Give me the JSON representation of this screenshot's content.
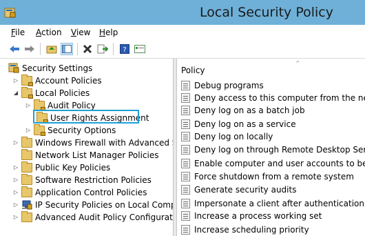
{
  "window": {
    "title": "Local Security Policy"
  },
  "menu": {
    "file": "File",
    "action": "Action",
    "view": "View",
    "help": "Help"
  },
  "tree": {
    "root": "Security Settings",
    "account_policies": "Account Policies",
    "local_policies": "Local Policies",
    "audit_policy": "Audit Policy",
    "user_rights": "User Rights Assignment",
    "security_options": "Security Options",
    "firewall": "Windows Firewall with Advanced Secu",
    "network_list": "Network List Manager Policies",
    "public_key": "Public Key Policies",
    "software_restriction": "Software Restriction Policies",
    "app_control": "Application Control Policies",
    "ip_security": "IP Security Policies on Local Compute",
    "advanced_audit": "Advanced Audit Policy Configuration"
  },
  "list": {
    "column": "Policy",
    "items": [
      "Debug programs",
      "Deny access to this computer from the network",
      "Deny log on as a batch job",
      "Deny log on as a service",
      "Deny log on locally",
      "Deny log on through Remote Desktop Services",
      "Enable computer and user accounts to be truste",
      "Force shutdown from a remote system",
      "Generate security audits",
      "Impersonate a client after authentication",
      "Increase a process working set",
      "Increase scheduling priority"
    ]
  },
  "colors": {
    "titlebar": "#6fb0d8",
    "highlight": "#1ea0d8"
  }
}
